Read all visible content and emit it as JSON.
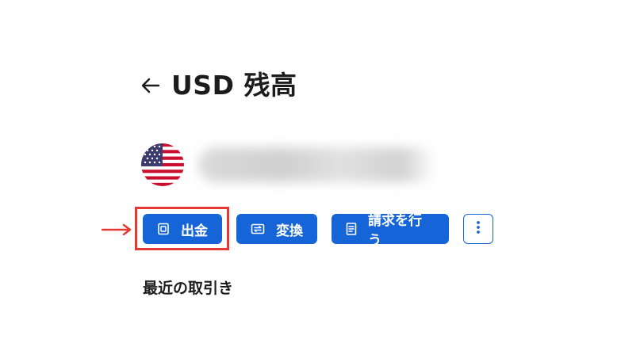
{
  "header": {
    "title": "USD 残高",
    "back_icon": "arrow-left-icon"
  },
  "balance": {
    "currency_flag": "us-flag-icon",
    "amount_obscured": true
  },
  "actions": {
    "withdraw_label": "出金",
    "withdraw_icon": "bank-card-icon",
    "exchange_label": "変換",
    "exchange_icon": "exchange-icon",
    "request_label": "請求を行う",
    "request_icon": "document-icon",
    "more_icon": "more-vertical-icon"
  },
  "annotation": {
    "highlight_color": "#e53935",
    "highlight_target": "withdraw-button"
  },
  "section": {
    "recent_transactions_title": "最近の取引き"
  },
  "colors": {
    "primary": "#1565d8",
    "text": "#1c1c1c",
    "annotation": "#e53935"
  }
}
